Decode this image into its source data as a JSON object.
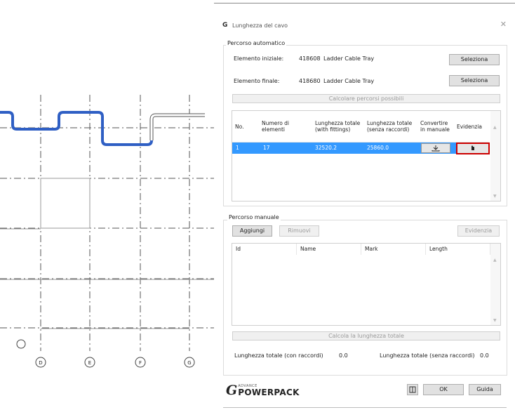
{
  "dialog": {
    "title": "Lunghezza del cavo",
    "close_icon": "close-icon",
    "app_icon": "advance-g-icon"
  },
  "auto_path": {
    "group_label": "Percorso automatico",
    "start_label": "Elemento iniziale:",
    "start_id": "418608",
    "start_type": "Ladder Cable Tray",
    "end_label": "Elemento finale:",
    "end_id": "418680",
    "end_type": "Ladder Cable Tray",
    "select_label": "Seleziona",
    "calc_paths_label": "Calcolare percorsi possibili",
    "table": {
      "headers": [
        "No.",
        "Numero di elementi",
        "Lunghezza totale (with fittings)",
        "Lunghezza totale (senza raccordi)",
        "Convertire in manuale",
        "Evidenzia"
      ],
      "rows": [
        {
          "no": "1",
          "count": "17",
          "total_with": "32520.2",
          "total_without": "25860.0"
        }
      ]
    },
    "convert_icon": "download-icon",
    "highlight_icon": "pointer-hand-icon"
  },
  "manual_path": {
    "group_label": "Percorso manuale",
    "add_label": "Aggiungi",
    "remove_label": "Rimuovi",
    "highlight_label": "Evidenzia",
    "columns": [
      "Id",
      "Name",
      "Mark",
      "Length"
    ],
    "calc_total_label": "Calcola la lunghezza totale",
    "total_with_label": "Lunghezza totale (con raccordi)",
    "total_with_value": "0.0",
    "total_without_label": "Lunghezza totale (senza raccordi)",
    "total_without_value": "0.0"
  },
  "footer": {
    "logo_small": "ADVANCE",
    "logo_big": "POWERPACK",
    "logo_g": "G",
    "help_icon": "book-icon",
    "ok_label": "OK",
    "guide_label": "Guida"
  },
  "drawing": {
    "grid_labels": [
      "D",
      "E",
      "F",
      "G"
    ],
    "tray_color": "#2f5fc4"
  }
}
